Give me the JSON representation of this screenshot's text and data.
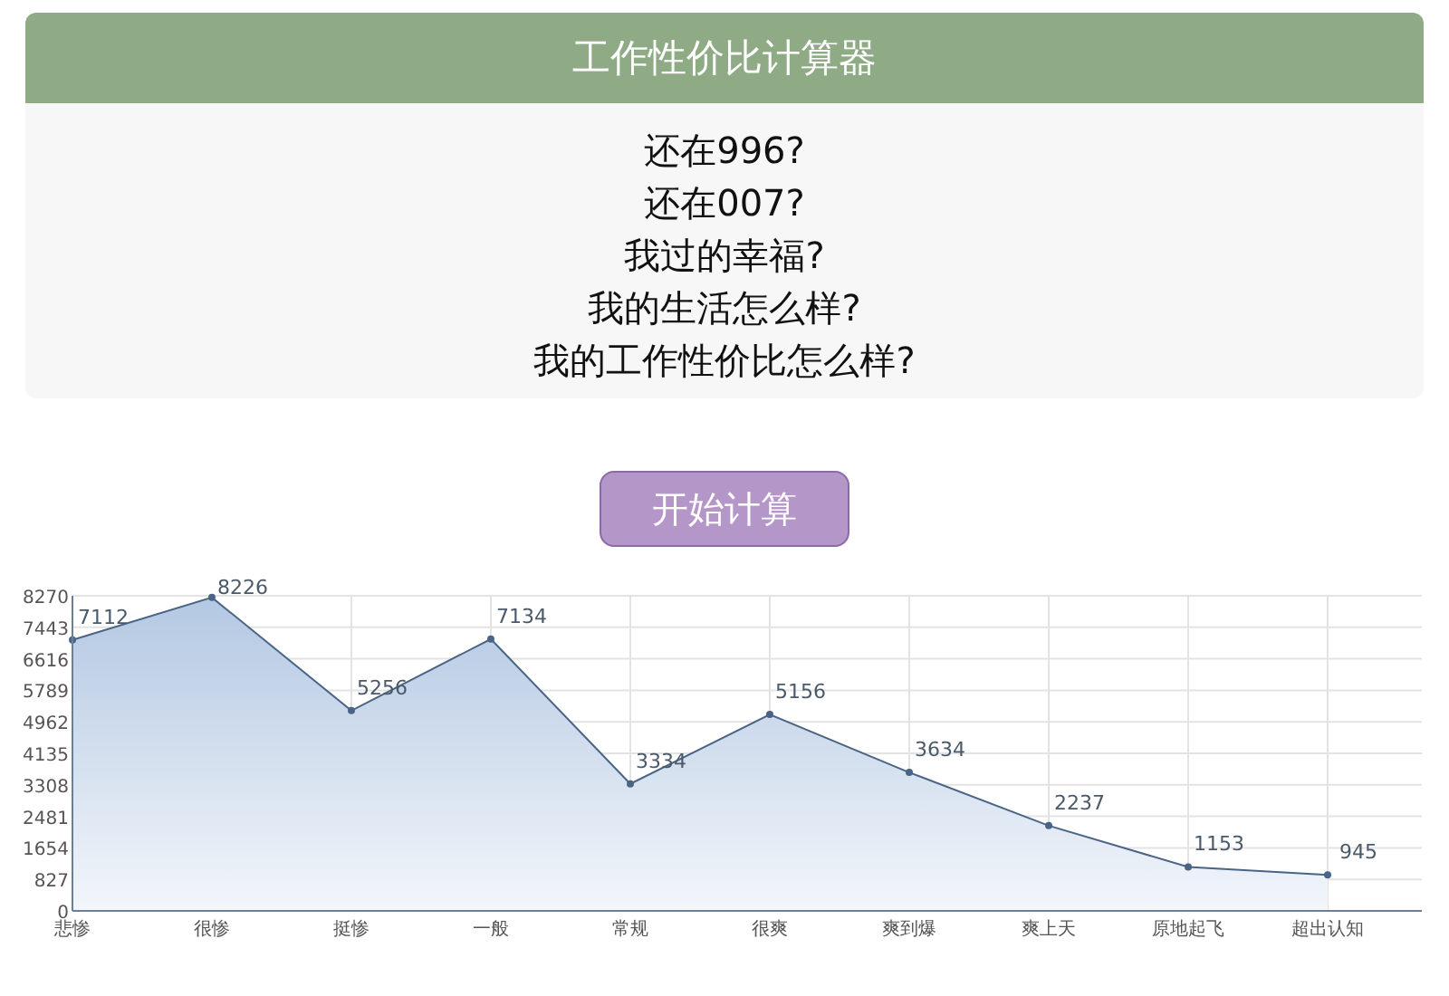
{
  "header": {
    "title": "工作性价比计算器"
  },
  "questions": [
    "还在996?",
    "还在007?",
    "我过的幸福?",
    "我的生活怎么样?",
    "我的工作性价比怎么样?"
  ],
  "button": {
    "label": "开始计算"
  },
  "chart": {
    "chart_data": {
      "type": "area",
      "categories": [
        "悲惨",
        "很惨",
        "挺惨",
        "一般",
        "常规",
        "很爽",
        "爽到爆",
        "爽上天",
        "原地起飞",
        "超出认知"
      ],
      "series": [
        {
          "color": "#4a6485",
          "values": [
            7112,
            8226,
            5256,
            7134,
            3334,
            5156,
            3634,
            2237,
            1153,
            945
          ]
        }
      ],
      "ylim": [
        0,
        8270
      ],
      "yticks": [
        0,
        827,
        1654,
        2481,
        3308,
        4135,
        4962,
        5789,
        6616,
        7443,
        8270
      ],
      "grid": true,
      "data_labels": true
    }
  }
}
